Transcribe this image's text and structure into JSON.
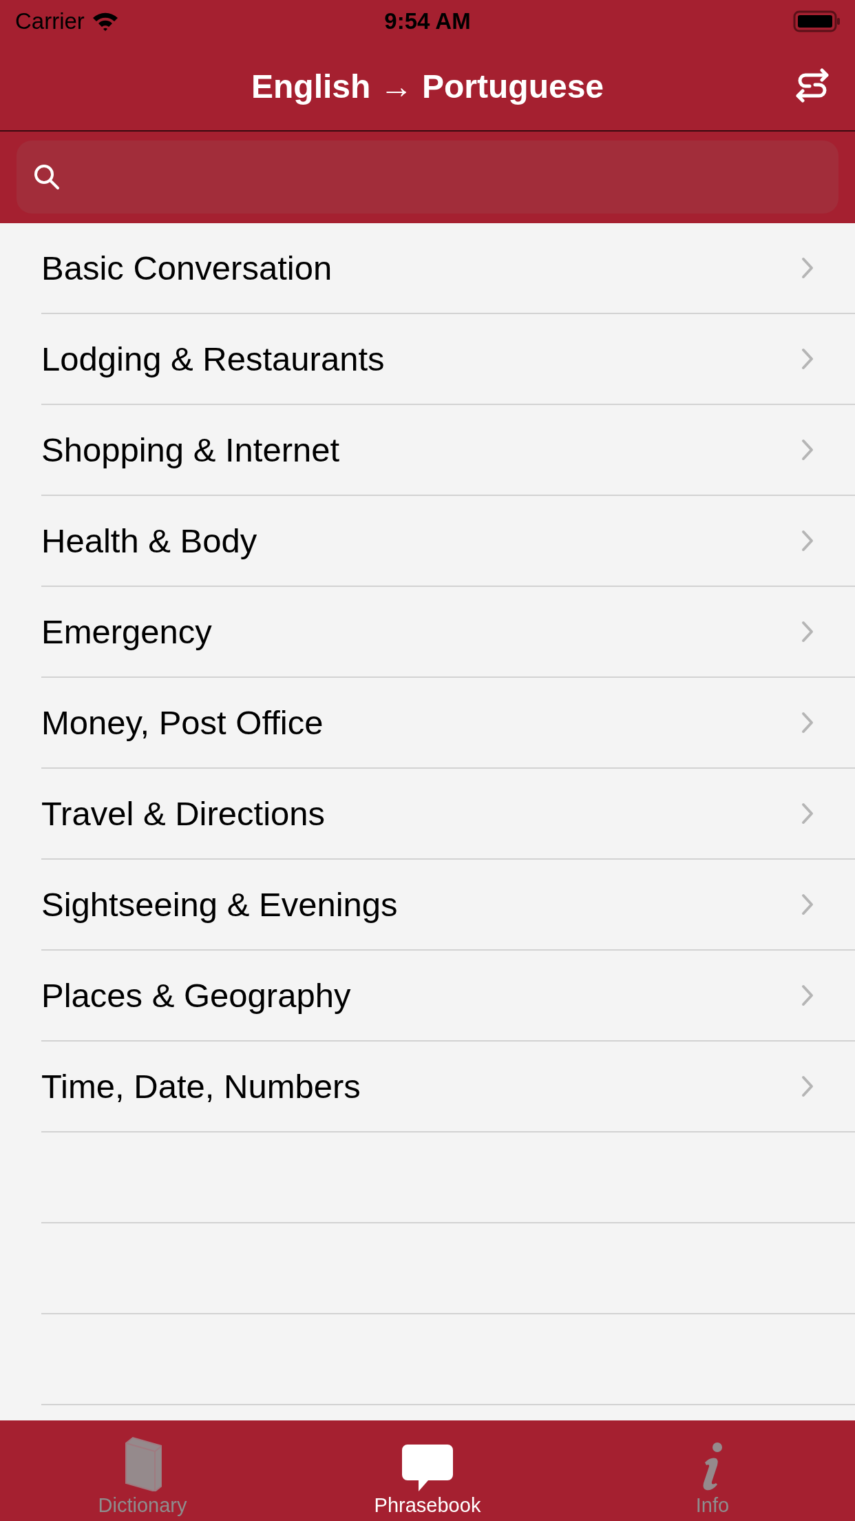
{
  "status_bar": {
    "carrier": "Carrier",
    "time": "9:54 AM"
  },
  "nav": {
    "title": "English → Portuguese"
  },
  "categories": [
    {
      "label": "Basic Conversation"
    },
    {
      "label": "Lodging & Restaurants"
    },
    {
      "label": "Shopping & Internet"
    },
    {
      "label": "Health & Body"
    },
    {
      "label": "Emergency"
    },
    {
      "label": "Money, Post Office"
    },
    {
      "label": "Travel & Directions"
    },
    {
      "label": "Sightseeing & Evenings"
    },
    {
      "label": "Places & Geography"
    },
    {
      "label": "Time, Date, Numbers"
    }
  ],
  "tabs": [
    {
      "label": "Dictionary",
      "kind": "book",
      "selected": false
    },
    {
      "label": "Phrasebook",
      "kind": "speech",
      "selected": true
    },
    {
      "label": "Info",
      "kind": "info",
      "selected": false
    }
  ]
}
